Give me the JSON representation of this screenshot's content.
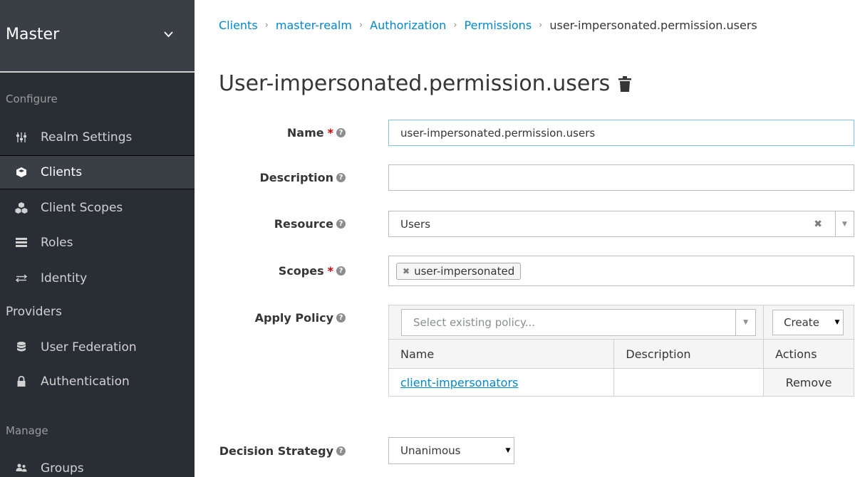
{
  "sidebar": {
    "realm": "Master",
    "configure_label": "Configure",
    "manage_label": "Manage",
    "items": [
      {
        "label": "Realm Settings",
        "icon": "sliders-icon"
      },
      {
        "label": "Clients",
        "icon": "cube-icon"
      },
      {
        "label": "Client Scopes",
        "icon": "cubes-icon"
      },
      {
        "label": "Roles",
        "icon": "list-icon"
      },
      {
        "label": "Identity",
        "icon": "exchange-icon"
      },
      {
        "label": "Providers"
      },
      {
        "label": "User Federation",
        "icon": "database-icon"
      },
      {
        "label": "Authentication",
        "icon": "lock-icon"
      }
    ],
    "manage_items": [
      {
        "label": "Groups",
        "icon": "users-icon"
      }
    ]
  },
  "breadcrumb": {
    "items": [
      "Clients",
      "master-realm",
      "Authorization",
      "Permissions"
    ],
    "current": "user-impersonated.permission.users"
  },
  "page": {
    "title": "User-impersonated.permission.users"
  },
  "form": {
    "name_label": "Name",
    "name_value": "user-impersonated.permission.users",
    "description_label": "Description",
    "description_value": "",
    "resource_label": "Resource",
    "resource_value": "Users",
    "scopes_label": "Scopes",
    "scope_tag": "user-impersonated",
    "apply_policy_label": "Apply Policy",
    "policy_placeholder": "Select existing policy...",
    "create_label": "Create",
    "table_headers": [
      "Name",
      "Description",
      "Actions"
    ],
    "policies": [
      {
        "name": "client-impersonators",
        "description": "",
        "action": "Remove"
      }
    ],
    "decision_label": "Decision Strategy",
    "decision_value": "Unanimous"
  },
  "colors": {
    "sidebar_bg": "#292e34",
    "link": "#0088ce",
    "required": "#cc0000"
  }
}
